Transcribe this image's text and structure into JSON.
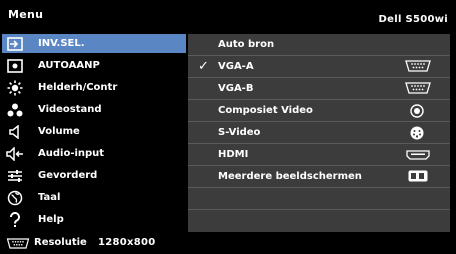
{
  "header": {
    "title": "Menu",
    "model": "Dell S500wi"
  },
  "left_menu": {
    "items": [
      {
        "label": "INV.SEL.",
        "icon": "input-select-icon",
        "selected": true
      },
      {
        "label": "AUTOAANP",
        "icon": "auto-adjust-icon"
      },
      {
        "label": "Helderh/Contr",
        "icon": "brightness-icon"
      },
      {
        "label": "Videostand",
        "icon": "video-mode-icon"
      },
      {
        "label": "Volume",
        "icon": "speaker-icon"
      },
      {
        "label": "Audio-input",
        "icon": "audio-input-icon"
      },
      {
        "label": "Gevorderd",
        "icon": "advanced-sliders-icon"
      },
      {
        "label": "Taal",
        "icon": "globe-icon"
      },
      {
        "label": "Help",
        "icon": "question-icon"
      }
    ]
  },
  "right_menu": {
    "items": [
      {
        "label": "Auto bron",
        "checked": false,
        "icon": null
      },
      {
        "label": "VGA-A",
        "checked": true,
        "icon": "vga-connector-icon"
      },
      {
        "label": "VGA-B",
        "checked": false,
        "icon": "vga-connector-icon"
      },
      {
        "label": "Composiet Video",
        "checked": false,
        "icon": "rca-connector-icon"
      },
      {
        "label": "S-Video",
        "checked": false,
        "icon": "s-video-connector-icon"
      },
      {
        "label": "HDMI",
        "checked": false,
        "icon": "hdmi-connector-icon"
      },
      {
        "label": "Meerdere beeldschermen",
        "checked": false,
        "icon": "multi-display-icon"
      },
      {
        "label": "",
        "checked": false,
        "icon": null
      }
    ],
    "check_glyph": "✓"
  },
  "footer": {
    "label": "Resolutie",
    "value": "1280x800",
    "icon": "vga-connector-icon"
  },
  "colors": {
    "background": "#000000",
    "selection": "#5a86c4",
    "panel": "#3c3c3c",
    "divider": "#5a5a5a"
  }
}
